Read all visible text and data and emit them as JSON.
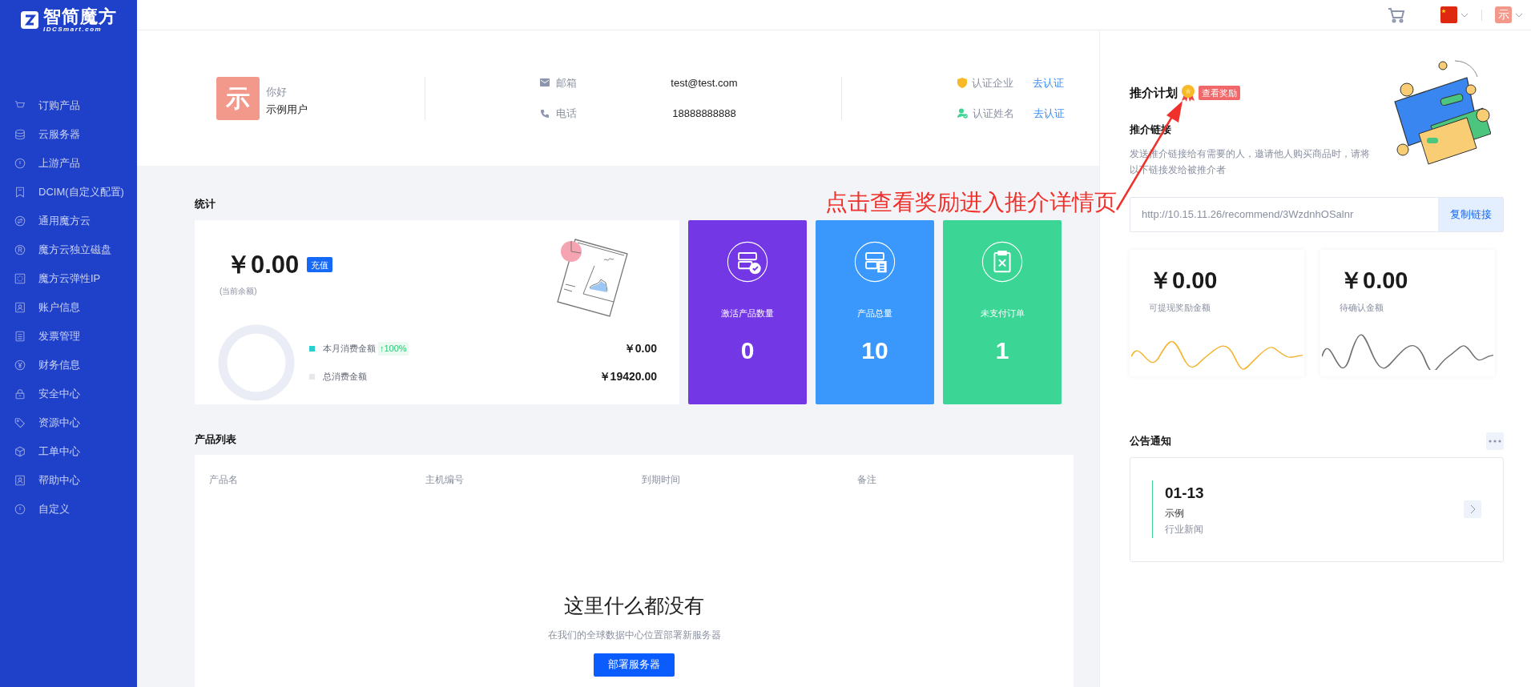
{
  "brand": {
    "name": "智简魔方",
    "domain": "IDCSmart.com"
  },
  "sidebar": {
    "items": [
      {
        "label": "订购产品",
        "kind": "cart"
      },
      {
        "label": "云服务器",
        "kind": "stack"
      },
      {
        "label": "上游产品",
        "kind": "alert"
      },
      {
        "label": "DCIM(自定义配置)",
        "kind": "bookmark"
      },
      {
        "label": "通用魔方云",
        "kind": "swap"
      },
      {
        "label": "魔方云独立磁盘",
        "kind": "registered"
      },
      {
        "label": "魔方云弹性IP",
        "kind": "frame"
      },
      {
        "label": "账户信息",
        "kind": "user"
      },
      {
        "label": "发票管理",
        "kind": "doc"
      },
      {
        "label": "财务信息",
        "kind": "yen"
      },
      {
        "label": "安全中心",
        "kind": "lock"
      },
      {
        "label": "资源中心",
        "kind": "tag"
      },
      {
        "label": "工单中心",
        "kind": "cube"
      },
      {
        "label": "帮助中心",
        "kind": "user"
      },
      {
        "label": "自定义",
        "kind": "alert"
      }
    ]
  },
  "top_bar": {
    "avatar_text": "示"
  },
  "profile": {
    "avatar_text": "示",
    "greeting": "你好",
    "username": "示例用户",
    "contacts": [
      {
        "kind": "email",
        "label": "邮箱",
        "value": "test@test.com"
      },
      {
        "kind": "phone",
        "label": "电话",
        "value": "18888888888"
      }
    ],
    "verifications": [
      {
        "kind": "company",
        "label": "认证企业",
        "action": "去认证"
      },
      {
        "kind": "person",
        "label": "认证姓名",
        "action": "去认证"
      }
    ]
  },
  "statistics": {
    "title": "统计",
    "balance": "￥0.00",
    "recharge": "充值",
    "balance_note": "(当前余额)",
    "legend": [
      {
        "label": "本月消费金额",
        "color": "#2ccfd0",
        "badge": "↑100%",
        "amount": "￥0.00"
      },
      {
        "label": "总消费金额",
        "color": "#e5e7eb",
        "amount": "￥19420.00"
      }
    ],
    "tiles": [
      {
        "kind": "active",
        "label": "激活产品数量",
        "value": "0",
        "color": "#7337e6"
      },
      {
        "kind": "total",
        "label": "产品总量",
        "value": "10",
        "color": "#3a98fc"
      },
      {
        "kind": "unpaid",
        "label": "未支付订单",
        "value": "1",
        "color": "#3bd595"
      }
    ]
  },
  "annotation": {
    "text": "点击查看奖励进入推介详情页"
  },
  "products": {
    "title": "产品列表",
    "columns": [
      "产品名",
      "主机编号",
      "到期时间",
      "备注"
    ],
    "empty": {
      "title": "这里什么都没有",
      "text": "在我们的全球数据中心位置部署新服务器",
      "button": "部署服务器"
    }
  },
  "referral": {
    "title": "推介计划",
    "badge": "查看奖励",
    "link_title": "推介链接",
    "description": "发送推介链接给有需要的人，邀请他人购买商品时，请将以下链接发给被推介者",
    "link": "http://10.15.11.26/recommend/3WzdnhOSalnr",
    "copy_button": "复制链接",
    "amounts": [
      {
        "value": "￥0.00",
        "label": "可提现奖励金额",
        "color": "#f5b22a"
      },
      {
        "value": "￥0.00",
        "label": "待确认金额",
        "color": "#707070"
      }
    ]
  },
  "notices": {
    "title": "公告通知",
    "items": [
      {
        "date": "01-13",
        "title": "示例",
        "category": "行业新闻"
      }
    ]
  }
}
